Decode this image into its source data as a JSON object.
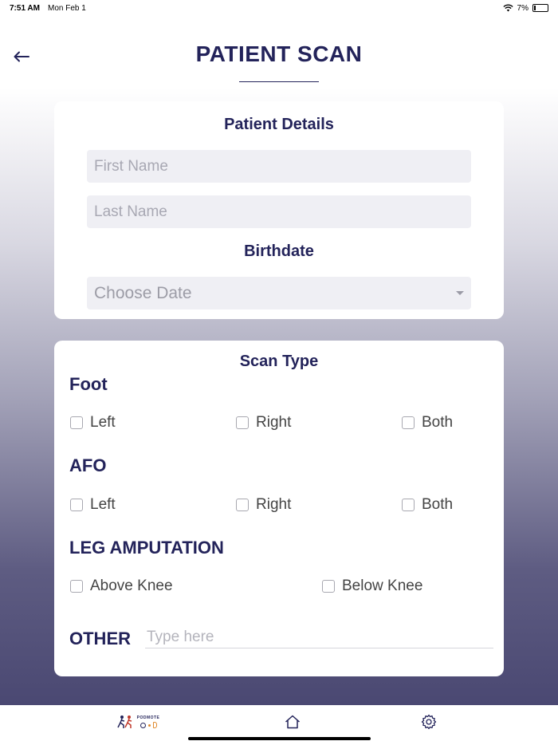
{
  "status_bar": {
    "time": "7:51 AM",
    "date": "Mon Feb 1",
    "battery": "7%"
  },
  "header": {
    "title": "PATIENT SCAN",
    "back_icon": "back-arrow-icon"
  },
  "patient_details": {
    "title": "Patient Details",
    "first_name_placeholder": "First Name",
    "last_name_placeholder": "Last Name",
    "birthdate_label": "Birthdate",
    "date_placeholder": "Choose Date"
  },
  "scan_type": {
    "title": "Scan Type",
    "foot": {
      "label": "Foot",
      "options": [
        "Left",
        "Right",
        "Both"
      ]
    },
    "afo": {
      "label": "AFO",
      "options": [
        "Left",
        "Right",
        "Both"
      ]
    },
    "leg_amputation": {
      "label": "LEG AMPUTATION",
      "options": [
        "Above Knee",
        "Below Knee"
      ]
    },
    "other": {
      "label": "OTHER",
      "placeholder": "Type here"
    }
  },
  "tab_bar": {
    "logo_text": "PODMOTE",
    "items": [
      {
        "name": "logo",
        "icon": "podmote-logo-icon"
      },
      {
        "name": "home",
        "icon": "home-icon"
      },
      {
        "name": "settings",
        "icon": "gear-icon"
      }
    ]
  },
  "colors": {
    "accent": "#23235a",
    "gradient_bottom": "#4a4872",
    "input_bg": "#efeff4"
  }
}
